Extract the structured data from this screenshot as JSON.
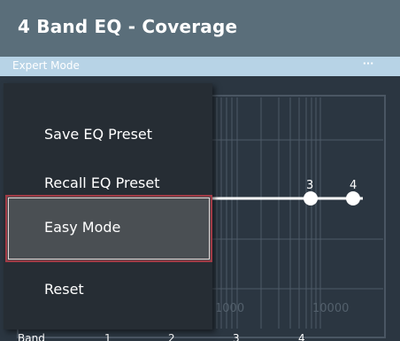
{
  "window": {
    "title": "4 Band EQ - Coverage"
  },
  "mode_bar": {
    "label": "Expert Mode",
    "more_label": "···"
  },
  "graph": {
    "freq_labels": [
      "1000",
      "10000"
    ],
    "band_markers": [
      "3",
      "4"
    ]
  },
  "bands": {
    "label": "Band",
    "numbers": [
      "1",
      "2",
      "3",
      "4"
    ]
  },
  "context_menu": {
    "items": [
      {
        "label": "Save EQ Preset"
      },
      {
        "label": "Recall EQ Preset"
      },
      {
        "label": "Easy Mode"
      },
      {
        "label": "Reset"
      }
    ],
    "highlighted_item": "Easy Mode"
  },
  "colors": {
    "title_bar": "#5a6e7a",
    "mode_bar": "#b7d3e6",
    "background": "#2e3a46",
    "menu_background": "#262d34",
    "highlight_border": "#a13b46"
  }
}
